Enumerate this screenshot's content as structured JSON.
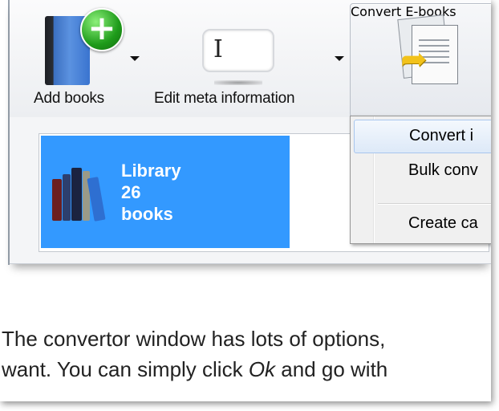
{
  "toolbar": {
    "add_books_label": "Add books",
    "edit_meta_label": "Edit meta information",
    "convert_label": "Convert E-books"
  },
  "library": {
    "line1": "Library",
    "line2": "26",
    "line3": "books"
  },
  "convert_menu": {
    "items": [
      {
        "label": "Convert i"
      },
      {
        "label": "Bulk conv"
      },
      {
        "label": "Create ca"
      }
    ]
  },
  "article": {
    "line1": "The convertor window has lots of options,",
    "line2_pre": "want.  You can simply click ",
    "line2_em": "Ok",
    "line2_post": " and go with"
  },
  "colors": {
    "library_tile": "#3399ff",
    "menu_hover": "#dde9f8"
  }
}
